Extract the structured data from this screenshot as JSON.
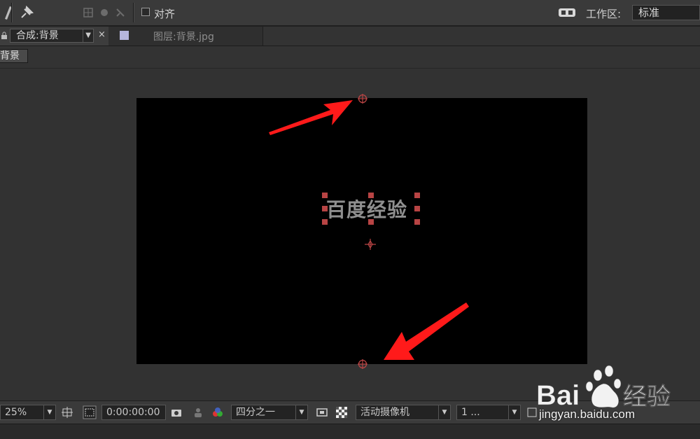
{
  "toolbar": {
    "snap_label": "对齐",
    "workspace_label": "工作区:",
    "workspace_value": "标准"
  },
  "tabs": {
    "composition_tab": "合成:背景",
    "close_symbol": "×",
    "layer_tab_prefix": "图层:背景",
    "layer_tab_ext": ".jpg"
  },
  "breadcrumb": {
    "label": "背景"
  },
  "viewer": {
    "text_layer": "百度经验",
    "canvas_color": "#000000",
    "selection_color": "#b84444",
    "arrow_color": "#ff1a1a"
  },
  "controls": {
    "zoom": "25%",
    "timecode": "0:00:00:00",
    "resolution": "四分之一",
    "camera": "活动摄像机",
    "views": "1 ..."
  },
  "watermark": {
    "logo_text": "Bai",
    "logo_text2": "经验",
    "url": "jingyan.baidu.com"
  }
}
